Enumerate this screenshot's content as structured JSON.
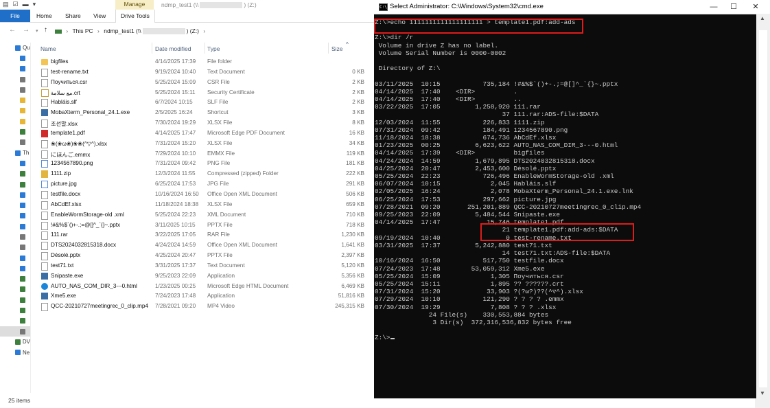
{
  "explorer": {
    "title_path_prefix": "ndmp_test1 (\\\\",
    "title_path_suffix": ") (Z:)",
    "manage_tab": "Manage",
    "ribbon_tabs": [
      "File",
      "Home",
      "Share",
      "View",
      "Drive Tools"
    ],
    "breadcrumb": {
      "root": "This PC",
      "drive_prefix": "ndmp_test1 (\\\\",
      "drive_suffix": ") (Z:)"
    },
    "nav_pane": [
      "Qu",
      "",
      "",
      "",
      "",
      "",
      "",
      "",
      "",
      "",
      "Th",
      "",
      "",
      "",
      "",
      "",
      "",
      "",
      "",
      "",
      "",
      "",
      "",
      "",
      "",
      "",
      "",
      "",
      "DV",
      "Ne"
    ],
    "columns": {
      "name": "Name",
      "date": "Date modified",
      "type": "Type",
      "size": "Size"
    },
    "files": [
      {
        "name": "bigfiles",
        "date": "4/14/2025 17:39",
        "type": "File folder",
        "size": "",
        "icon": "folder"
      },
      {
        "name": "test-rename.txt",
        "date": "9/19/2024 10:40",
        "type": "Text Document",
        "size": "0 KB",
        "icon": "doc"
      },
      {
        "name": "Поучиться.csr",
        "date": "5/25/2024 15:09",
        "type": "CSR File",
        "size": "2 KB",
        "icon": "doc"
      },
      {
        "name": "مع سلامة.crt",
        "date": "5/25/2024 15:11",
        "type": "Security Certificate",
        "size": "2 KB",
        "icon": "cert"
      },
      {
        "name": "Habláis.slf",
        "date": "6/7/2024 10:15",
        "type": "SLF File",
        "size": "2 KB",
        "icon": "doc"
      },
      {
        "name": "MobaXterm_Personal_24.1.exe",
        "date": "2/5/2025 16:24",
        "type": "Shortcut",
        "size": "3 KB",
        "icon": "app"
      },
      {
        "name": "조선말.xlsx",
        "date": "7/30/2024 19:29",
        "type": "XLSX File",
        "size": "8 KB",
        "icon": "doc"
      },
      {
        "name": "template1.pdf",
        "date": "4/14/2025 17:47",
        "type": "Microsoft Edge PDF Document",
        "size": "16 KB",
        "icon": "pdf"
      },
      {
        "name": "❀(❀ω❀)❀❀(^▽^).xlsx",
        "date": "7/31/2024 15:20",
        "type": "XLSX File",
        "size": "34 KB",
        "icon": "doc"
      },
      {
        "name": "にほんご.emmx",
        "date": "7/29/2024 10:10",
        "type": "EMMX File",
        "size": "119 KB",
        "icon": "doc"
      },
      {
        "name": "1234567890.png",
        "date": "7/31/2024 09:42",
        "type": "PNG File",
        "size": "181 KB",
        "icon": "img"
      },
      {
        "name": "1111.zip",
        "date": "12/3/2024 11:55",
        "type": "Compressed (zipped) Folder",
        "size": "222 KB",
        "icon": "zip"
      },
      {
        "name": "picture.jpg",
        "date": "6/25/2024 17:53",
        "type": "JPG File",
        "size": "291 KB",
        "icon": "img"
      },
      {
        "name": "testfile.docx",
        "date": "10/16/2024 16:50",
        "type": "Office Open XML Document",
        "size": "506 KB",
        "icon": "doc"
      },
      {
        "name": "AbCdEf.xlsx",
        "date": "11/18/2024 18:38",
        "type": "XLSX File",
        "size": "659 KB",
        "icon": "doc"
      },
      {
        "name": "EnableWormStorage-old .xml",
        "date": "5/25/2024 22:23",
        "type": "XML Document",
        "size": "710 KB",
        "icon": "doc"
      },
      {
        "name": "!#&%$`()+-.;=@[]^_`{}~.pptx",
        "date": "3/11/2025 10:15",
        "type": "PPTX File",
        "size": "718 KB",
        "icon": "doc"
      },
      {
        "name": "111.rar",
        "date": "3/22/2025 17:05",
        "type": "RAR File",
        "size": "1,230 KB",
        "icon": "doc"
      },
      {
        "name": "DTS2024032815318.docx",
        "date": "4/24/2024 14:59",
        "type": "Office Open XML Document",
        "size": "1,641 KB",
        "icon": "doc"
      },
      {
        "name": "Désolé.pptx",
        "date": "4/25/2024 20:47",
        "type": "PPTX File",
        "size": "2,397 KB",
        "icon": "doc"
      },
      {
        "name": "test71.txt",
        "date": "3/31/2025 17:37",
        "type": "Text Document",
        "size": "5,120 KB",
        "icon": "doc"
      },
      {
        "name": "Snipaste.exe",
        "date": "9/25/2023 22:09",
        "type": "Application",
        "size": "5,356 KB",
        "icon": "app"
      },
      {
        "name": "AUTO_NAS_COM_DIR_3---0.html",
        "date": "1/23/2025 00:25",
        "type": "Microsoft Edge HTML Document",
        "size": "6,469 KB",
        "icon": "edge"
      },
      {
        "name": "Xme5.exe",
        "date": "7/24/2023 17:48",
        "type": "Application",
        "size": "51,816 KB",
        "icon": "app"
      },
      {
        "name": "QCC-20210727meetingrec_0_clip.mp4",
        "date": "7/28/2021 09:20",
        "type": "MP4 Video",
        "size": "245,315 KB",
        "icon": "doc"
      }
    ],
    "status": "25 items"
  },
  "cmd": {
    "title": "Select Administrator: C:\\Windows\\System32\\cmd.exe",
    "lines": [
      "Z:\\>echo 1111111111111111111 > template1.pdf:add-ads",
      "",
      "Z:\\>dir /r",
      " Volume in drive Z has no label.",
      " Volume Serial Number is 0000-0002",
      "",
      " Directory of Z:\\",
      "",
      "03/11/2025  10:15           735,184 !#&%$`()+-.;=@[]^_`{}~.pptx",
      "04/14/2025  17:40    <DIR>          .",
      "04/14/2025  17:40    <DIR>          ..",
      "03/22/2025  17:05         1,258,920 111.rar",
      "                                 37 111.rar:ADS-file:$DATA",
      "12/03/2024  11:55           226,833 1111.zip",
      "07/31/2024  09:42           184,491 1234567890.png",
      "11/18/2024  18:38           674,736 AbCdEf.xlsx",
      "01/23/2025  00:25         6,623,622 AUTO_NAS_COM_DIR_3---0.html",
      "04/14/2025  17:39    <DIR>          bigfiles",
      "04/24/2024  14:59         1,679,895 DTS2024032815318.docx",
      "04/25/2024  20:47         2,453,600 Désolé.pptx",
      "05/25/2024  22:23           726,496 EnableWormStorage-old .xml",
      "06/07/2024  10:15             2,045 Habláis.slf",
      "02/05/2025  16:24             2,078 MobaXterm_Personal_24.1.exe.lnk",
      "06/25/2024  17:53           297,662 picture.jpg",
      "07/28/2021  09:20       251,201,889 QCC-20210727meetingrec_0_clip.mp4",
      "09/25/2023  22:09         5,484,544 Snipaste.exe",
      "04/14/2025  17:47            15,746 template1.pdf",
      "                                 21 template1.pdf:add-ads:$DATA",
      "09/19/2024  10:40                 0 test-rename.txt",
      "03/31/2025  17:37         5,242,880 test71.txt",
      "                                 14 test71.txt:ADS-file:$DATA",
      "10/16/2024  16:50           517,750 testfile.docx",
      "07/24/2023  17:48        53,059,312 Xme5.exe",
      "05/25/2024  15:09             1,305 Поучиться.csr",
      "05/25/2024  15:11             1,895 ?? ??????.crt",
      "07/31/2024  15:20            33,903 ?(?ω?)??(^▽^).xlsx",
      "07/29/2024  10:10           121,290 ? ? ? ? .emmx",
      "07/30/2024  19:29             7,808 ? ? ? .xlsx",
      "              24 File(s)    330,553,884 bytes",
      "               3 Dir(s)  372,316,536,832 bytes free",
      "",
      "Z:\\>"
    ]
  }
}
